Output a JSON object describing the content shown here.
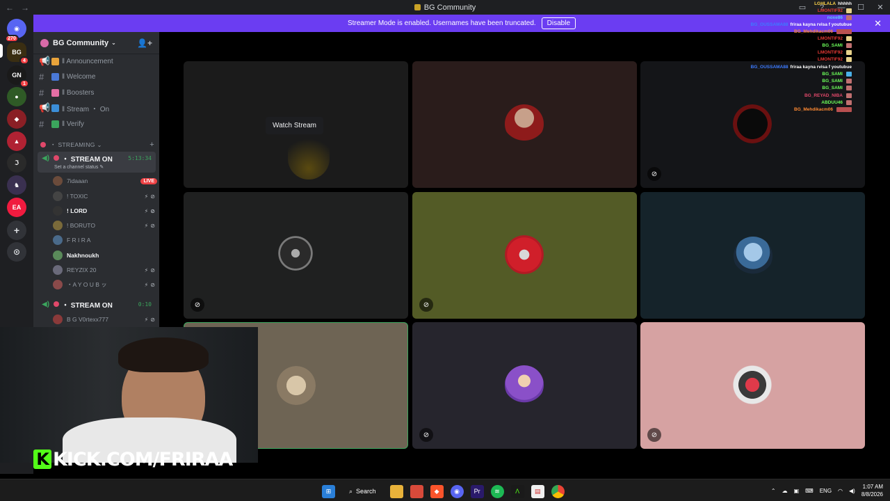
{
  "window": {
    "title": "BG Community",
    "back_icon": "←",
    "forward_icon": "→",
    "controls": [
      "▭",
      "?",
      "—",
      "☐",
      "✕"
    ]
  },
  "banner": {
    "text": "Streamer Mode is enabled. Usernames have been truncated.",
    "button": "Disable",
    "close": "✕"
  },
  "rail": {
    "home_badge": "270",
    "badges": [
      "4",
      "2",
      "1"
    ]
  },
  "server": {
    "name": "BG Community",
    "chevron": "⌄",
    "invite": "👤+"
  },
  "channels": [
    {
      "icon": "📢",
      "label": "‖ Announcement",
      "emoji_color": "#e8a33b"
    },
    {
      "icon": "#",
      "label": "‖ Welcome",
      "emoji_color": "#4a79d8"
    },
    {
      "icon": "#",
      "label": "‖ Boosters",
      "emoji_color": "#e56fa5"
    },
    {
      "icon": "📢",
      "label": "‖ Stream ・ On",
      "emoji_color": "#3b8ed8"
    },
    {
      "icon": "#",
      "label": "‖ Verify",
      "emoji_color": "#3ba55d"
    }
  ],
  "category": {
    "label": "・ STREAMING ⌄",
    "plus": "+"
  },
  "voice1": {
    "name": "・ STREAM ON",
    "timer": "5:13:34",
    "status": "Set a channel status ✎",
    "users": [
      {
        "name": "7idaaan",
        "badge": "LIVE",
        "color": "#6b4b3b"
      },
      {
        "name": "! TOXIC",
        "color": "#444"
      },
      {
        "name": "! LORD",
        "color": "#333",
        "bold": true
      },
      {
        "name": "! BORUTO",
        "color": "#7a6a3a"
      },
      {
        "name": "F R I R A",
        "color": "#4a6a8a"
      },
      {
        "name": "Nakhnoukh",
        "color": "#5a8a5a",
        "bold": true
      },
      {
        "name": "REYZIX 20",
        "color": "#6a6a7a"
      },
      {
        "name": "・A Y O U B ッ",
        "color": "#8a4a4a"
      }
    ],
    "mute_icons": "⚡⊘"
  },
  "voice2": {
    "name": "・ STREAM ON",
    "timer": "0:10",
    "users": [
      {
        "name": "B G V0rtexx777",
        "color": "#8a3a3a"
      }
    ]
  },
  "stage": {
    "watch_label": "Watch Stream",
    "mic_icon": "⊘"
  },
  "chat": [
    {
      "name": "LGHLALA",
      "color": "#ffd54a",
      "msg": "hhhhh"
    },
    {
      "name": "LMONTIF92",
      "color": "#e53935",
      "msg": ""
    },
    {
      "name": "noxe86",
      "color": "#5cc8ff",
      "msg": ""
    },
    {
      "name": "BG_OUSSAMA88",
      "color": "#3d7bff",
      "msg": "friraa kayna rvisa f youtubue"
    },
    {
      "name": "BG_Mehdikacm06",
      "color": "#ff8a33",
      "msg": ""
    },
    {
      "name": "LMONTIF92",
      "color": "#e53935",
      "msg": ""
    },
    {
      "name": "BG_SAMI",
      "color": "#6dff5a",
      "msg": ""
    },
    {
      "name": "LMONTIF92",
      "color": "#e53935",
      "msg": ""
    },
    {
      "name": "LMONTIF92",
      "color": "#e53935",
      "msg": ""
    },
    {
      "name": "BG_OUSSAMA88",
      "color": "#3d7bff",
      "msg": "friraa kayna rvisa f youtubue"
    },
    {
      "name": "BG_SAMI",
      "color": "#6dff5a",
      "msg": ""
    },
    {
      "name": "BG_SAMI",
      "color": "#6dff5a",
      "msg": ""
    },
    {
      "name": "BG_SAMI",
      "color": "#6dff5a",
      "msg": ""
    },
    {
      "name": "BG_REYAD_NIBA",
      "color": "#e0486a",
      "msg": ""
    },
    {
      "name": "ABDUU46",
      "color": "#6dff5a",
      "msg": ""
    },
    {
      "name": "BG_Mehdikacm06",
      "color": "#ff8a33",
      "msg": ""
    }
  ],
  "overlay": {
    "kick_logo": "K",
    "kick_url": "KICK.COM/FRIRAA"
  },
  "taskbar": {
    "search": "Search",
    "lang": "ENG",
    "time": "1:07 AM",
    "date": "8/8/2026",
    "tray_up": "⌃"
  }
}
